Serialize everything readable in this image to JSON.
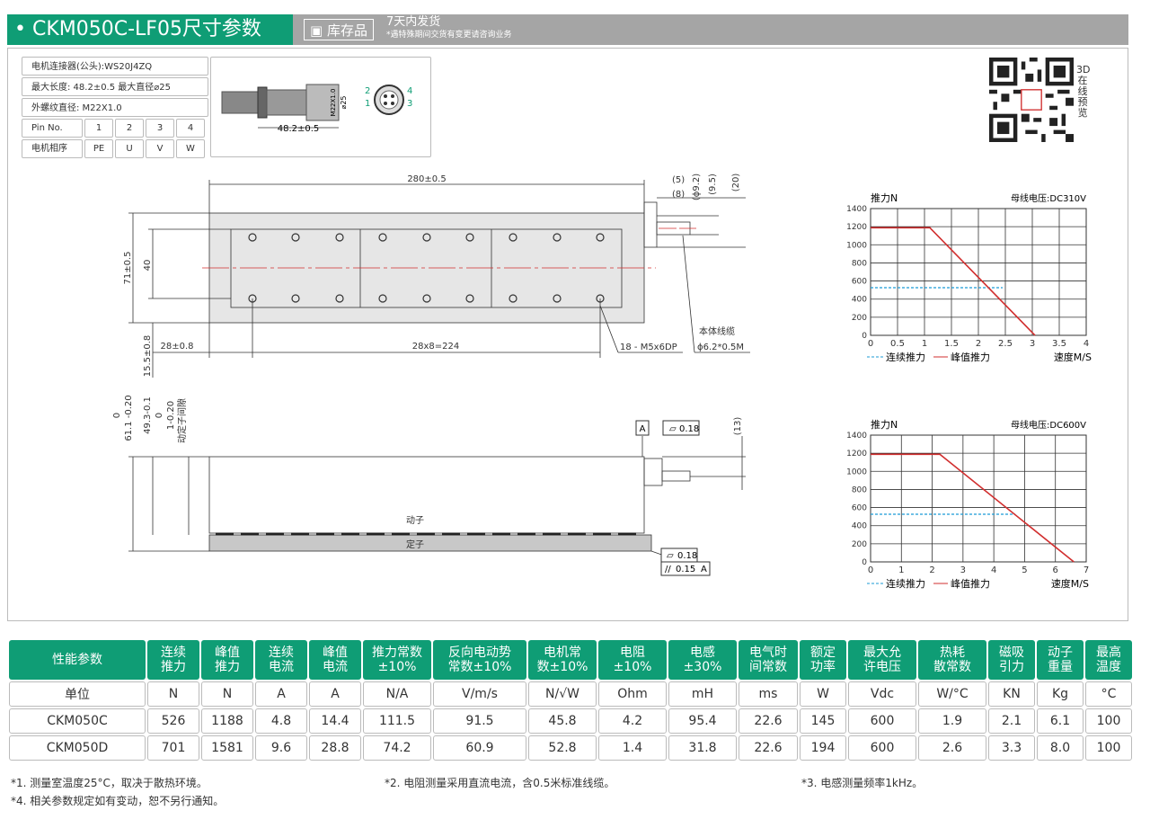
{
  "header": {
    "title": "• CKM050C-LF05尺寸参数",
    "stock_badge": "库存品",
    "ship_time": "7天内发货",
    "ship_note": "*遇特殊期间交货有变更请咨询业务"
  },
  "connector": {
    "rows": [
      "电机连接器(公头):WS20J4ZQ",
      "最大长度: 48.2±0.5   最大直径⌀25",
      "外螺纹直径:  M22X1.0"
    ],
    "pin_label": "Pin No.",
    "pins": [
      "1",
      "2",
      "3",
      "4"
    ],
    "phase_label": "电机相序",
    "phases": [
      "PE",
      "U",
      "V",
      "W"
    ],
    "dim_length": "48.2±0.5",
    "dim_thread": "M22X1.0",
    "dim_dia": "⌀25",
    "pin_numbers": [
      "2",
      "4",
      "1",
      "3"
    ]
  },
  "qr": {
    "label": "3D在线预览"
  },
  "drawing_top": {
    "overall_length": "280±0.5",
    "width": "71±0.5",
    "hole_spacing": "40",
    "offset": "28±0.8",
    "pitch": "28x8=224",
    "bottom_margin": "15.5±0.8",
    "holes": "18 - M5x6DP",
    "cable_label": "本体线缆",
    "cable_spec": "ϕ6.2*0.5M",
    "dim_5": "(5)",
    "dim_8": "(8)",
    "dim_92": "(ϕ9.2)",
    "dim_95": "(9.5)",
    "dim_20": "(20)"
  },
  "drawing_side": {
    "dim_a": "61.1 -0.20",
    "dim_a_top": "0",
    "dim_b": "49.3-0.1",
    "dim_c_top": "0",
    "dim_c": "1-0.20",
    "dim_c_note": "动定子间隙",
    "datum": "A",
    "flat1": "0.18",
    "dim_13": "(13)",
    "mover": "动子",
    "stator": "定子",
    "flat2": "0.18",
    "parallel": "0.15",
    "datum_ref": "A"
  },
  "chart_data": [
    {
      "type": "line",
      "ylabel": "推力N",
      "xlabel": "速度M/S",
      "voltage": "母线电压:DC310V",
      "xlim": [
        0,
        4
      ],
      "ylim": [
        0,
        1400
      ],
      "xticks": [
        "0",
        "0.5",
        "1",
        "1.5",
        "2",
        "2.5",
        "3",
        "3.5",
        "4"
      ],
      "yticks": [
        "0",
        "200",
        "400",
        "600",
        "800",
        "1000",
        "1200",
        "1400"
      ],
      "grid": true,
      "series": [
        {
          "name": "连续推力",
          "color": "#1b9bd6",
          "dashed": true,
          "x": [
            0,
            2.45
          ],
          "y": [
            526,
            526
          ]
        },
        {
          "name": "峰值推力",
          "color": "#d12f2f",
          "dashed": false,
          "x": [
            0,
            1.1,
            3.05
          ],
          "y": [
            1188,
            1188,
            0
          ]
        }
      ]
    },
    {
      "type": "line",
      "ylabel": "推力N",
      "xlabel": "速度M/S",
      "voltage": "母线电压:DC600V",
      "xlim": [
        0,
        7
      ],
      "ylim": [
        0,
        1400
      ],
      "xticks": [
        "0",
        "1",
        "2",
        "3",
        "4",
        "5",
        "6",
        "7"
      ],
      "yticks": [
        "0",
        "200",
        "400",
        "600",
        "800",
        "1000",
        "1200",
        "1400"
      ],
      "grid": true,
      "series": [
        {
          "name": "连续推力",
          "color": "#1b9bd6",
          "dashed": true,
          "x": [
            0,
            4.7
          ],
          "y": [
            526,
            526
          ]
        },
        {
          "name": "峰值推力",
          "color": "#d12f2f",
          "dashed": false,
          "x": [
            0,
            2.25,
            6.6
          ],
          "y": [
            1188,
            1188,
            0
          ]
        }
      ]
    }
  ],
  "perf_table": {
    "headers": [
      "性能参数",
      "连续\n推力",
      "峰值\n推力",
      "连续\n电流",
      "峰值\n电流",
      "推力常数\n±10%",
      "反向电动势\n常数±10%",
      "电机常\n数±10%",
      "电阻\n±10%",
      "电感\n±30%",
      "电气时\n间常数",
      "额定\n功率",
      "最大允\n许电压",
      "热耗\n散常数",
      "磁吸\n引力",
      "动子\n重量",
      "最高\n温度"
    ],
    "rows": [
      [
        "单位",
        "N",
        "N",
        "A",
        "A",
        "N/A",
        "V/m/s",
        "N/√W",
        "Ohm",
        "mH",
        "ms",
        "W",
        "Vdc",
        "W/°C",
        "KN",
        "Kg",
        "°C"
      ],
      [
        "CKM050C",
        "526",
        "1188",
        "4.8",
        "14.4",
        "111.5",
        "91.5",
        "45.8",
        "4.2",
        "95.4",
        "22.6",
        "145",
        "600",
        "1.9",
        "2.1",
        "6.1",
        "100"
      ],
      [
        "CKM050D",
        "701",
        "1581",
        "9.6",
        "28.8",
        "74.2",
        "60.9",
        "52.8",
        "1.4",
        "31.8",
        "22.6",
        "194",
        "600",
        "2.6",
        "3.3",
        "8.0",
        "100"
      ]
    ]
  },
  "notes": [
    "*1. 测量室温度25°C，取决于散热环境。",
    "*2. 电阻测量采用直流电流，含0.5米标准线缆。",
    "*3. 电感测量频率1kHz。",
    "*4. 相关参数规定如有变动，恕不另行通知。"
  ]
}
